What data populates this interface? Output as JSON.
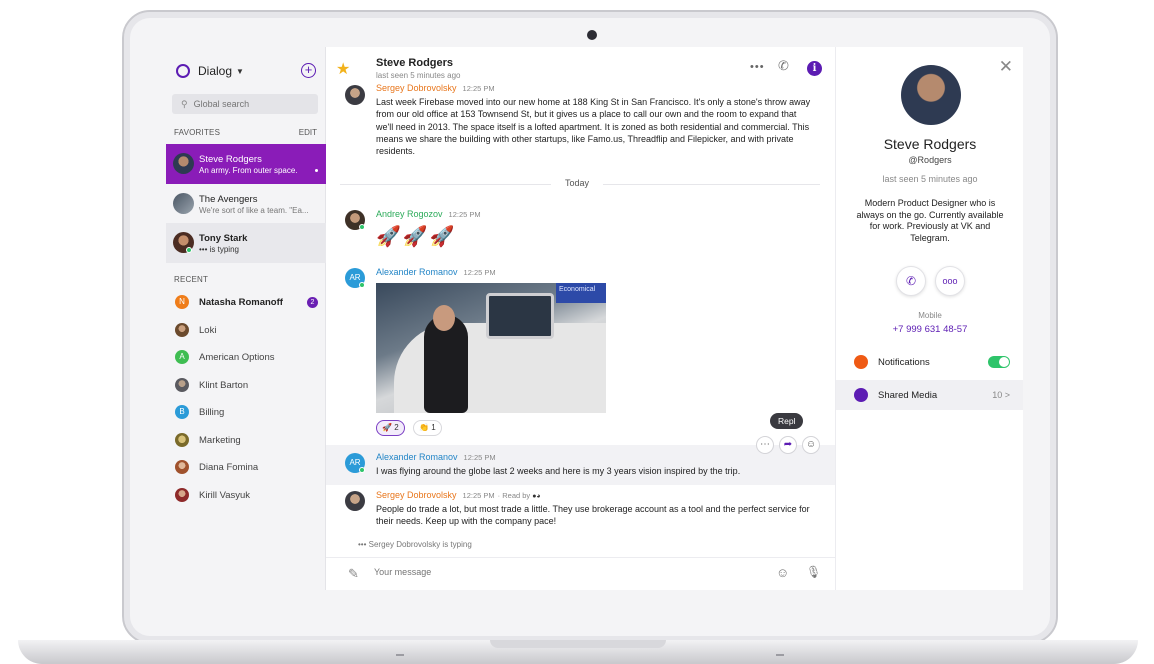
{
  "app": {
    "name": "Dialog",
    "add_button": "+"
  },
  "colors": {
    "brand": "#5c1cb3",
    "active_chat": "#8a1cb8",
    "star": "#f2b21c",
    "online": "#2ec46a",
    "author_green": "#2cab5a",
    "author_blue": "#2486c7",
    "author_orange": "#e8761c"
  },
  "sidebar": {
    "search_placeholder": "Global search",
    "favorites_label": "FAVORITES",
    "edit_label": "EDIT",
    "favorites": [
      {
        "name": "Steve Rodgers",
        "preview": "An army. From outer space."
      },
      {
        "name": "The Avengers",
        "preview": "We're sort of like a team. \"Ea..."
      },
      {
        "name": "Tony Stark",
        "preview": "••• is typing"
      }
    ],
    "recent_label": "RECENT",
    "recent": [
      {
        "name": "Natasha Romanoff",
        "initial": "N",
        "badge": "2",
        "color": "#ef7d1a"
      },
      {
        "name": "Loki",
        "initial": "",
        "color": "#6b4a2d"
      },
      {
        "name": "American Options",
        "initial": "A",
        "color": "#3fbd52"
      },
      {
        "name": "Klint Barton",
        "initial": "",
        "color": "#5a5a60"
      },
      {
        "name": "Billing",
        "initial": "B",
        "color": "#2b9bd8"
      },
      {
        "name": "Marketing",
        "initial": "",
        "color": "#7a6a2a"
      },
      {
        "name": "Diana Fomina",
        "initial": "",
        "color": "#a0522d"
      },
      {
        "name": "Kirill Vasyuk",
        "initial": "",
        "color": "#8e2a2a"
      }
    ]
  },
  "conversation": {
    "peer_name": "Steve Rodgers",
    "peer_status": "last seen 5 minutes ago",
    "more_icon": "more-horizontal-icon",
    "call_icon": "phone-icon",
    "info_label": "i",
    "day_divider": "Today",
    "messages": [
      {
        "author": "Sergey Dobrovolsky",
        "time": "12:25 PM",
        "text": "Last week Firebase moved into our new home at 188 King St in San Francisco. It's only a stone's throw away from our old office at 153 Townsend St, but it gives us a place to call our own and the room to expand that we'll need in 2013. The space itself is a lofted apartment. It is zoned as both residential and commercial. This means we share the building with other startups, like Famo.us, Threadflip and Filepicker, and with private residents."
      },
      {
        "author": "Andrey Rogozov",
        "time": "12:25 PM",
        "text": "🚀🚀🚀"
      },
      {
        "author": "Alexander Romanov",
        "initials": "AR",
        "time": "12:25 PM",
        "photo_caption": "Economical"
      },
      {
        "author": "Alexander Romanov",
        "initials": "AR",
        "time": "12:25 PM",
        "text": "I was flying around the globe last 2 weeks and here is my 3 years vision inspired by the trip."
      },
      {
        "author": "Sergey Dobrovolsky",
        "time": "12:25 PM",
        "read_by": "· Read by",
        "text": "People do trade a lot, but most trade a little. They use brokerage account as a tool and the perfect service for their needs. Keep up with the company pace!"
      }
    ],
    "reactions": [
      {
        "emoji": "🚀",
        "count": "2"
      },
      {
        "emoji": "👏",
        "count": "1"
      }
    ],
    "reply_tooltip": "Repl",
    "typing_indicator": "••• Sergey Dobrovolsky is typing",
    "compose_placeholder": "Your message"
  },
  "profile": {
    "name": "Steve Rodgers",
    "handle": "@Rodgers",
    "status": "last seen 5 minutes ago",
    "bio": "Modern Product Designer who is always on the go. Currently available for work. Previously at VK and Telegram.",
    "mobile_label": "Mobile",
    "mobile": "+7 999 631 48-57",
    "notifications_label": "Notifications",
    "notifications_on": true,
    "shared_media_label": "Shared Media",
    "shared_media_count": "10 >"
  }
}
